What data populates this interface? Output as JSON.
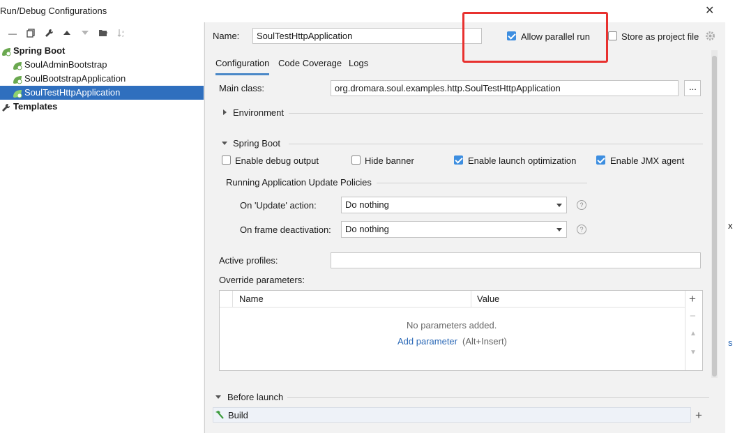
{
  "window": {
    "title": "Run/Debug Configurations",
    "close_glyph": "✕"
  },
  "toolbar": [
    "minus-icon",
    "copy-icon",
    "wrench-icon",
    "arrow-up-icon",
    "arrow-down-icon",
    "folder-icon",
    "sort-icon"
  ],
  "tree": {
    "group_label": "Spring Boot",
    "items": [
      "SoulAdminBootstrap",
      "SoulBootstrapApplication",
      "SoulTestHttpApplication"
    ],
    "templates_label": "Templates"
  },
  "header": {
    "name_label": "Name:",
    "name_value": "SoulTestHttpApplication",
    "allow_parallel_label": "Allow parallel run",
    "allow_parallel_checked": true,
    "store_project_label": "Store as project file",
    "store_project_checked": false
  },
  "tabs": [
    "Configuration",
    "Code Coverage",
    "Logs"
  ],
  "config": {
    "main_class_label": "Main class:",
    "main_class_value": "org.dromara.soul.examples.http.SoulTestHttpApplication",
    "browse_label": "...",
    "environment_label": "Environment",
    "spring_boot_label": "Spring Boot",
    "enable_debug_label": "Enable debug output",
    "enable_debug_checked": false,
    "hide_banner_label": "Hide banner",
    "hide_banner_checked": false,
    "launch_opt_label": "Enable launch optimization",
    "launch_opt_checked": true,
    "jmx_label": "Enable JMX agent",
    "jmx_checked": true,
    "policies_label": "Running Application Update Policies",
    "on_update_label": "On 'Update' action:",
    "on_update_value": "Do nothing",
    "on_frame_label": "On frame deactivation:",
    "on_frame_value": "Do nothing",
    "help_glyph": "?",
    "active_profiles_label": "Active profiles:",
    "active_profiles_value": "",
    "override_label": "Override parameters:",
    "table_headers": [
      "Name",
      "Value"
    ],
    "empty_text": "No parameters added.",
    "add_param_link": "Add parameter",
    "add_param_hint": "(Alt+Insert)",
    "table_actions": [
      "+",
      "−",
      "▲",
      "▼"
    ]
  },
  "before_launch": {
    "label": "Before launch",
    "items": [
      "Build"
    ],
    "add_glyph": "+"
  },
  "edge_fragments": [
    "x",
    "s"
  ]
}
